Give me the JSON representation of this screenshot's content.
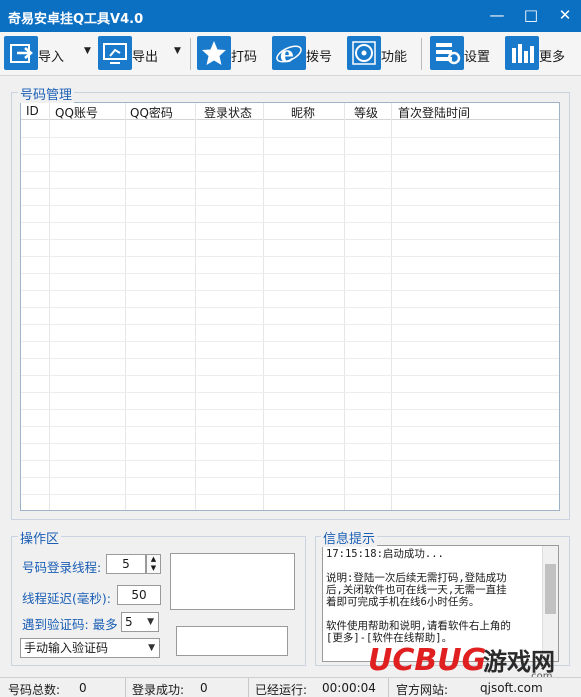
{
  "window": {
    "title": "奇易安卓挂Q工具V4.0"
  },
  "toolbar": {
    "import": "导入",
    "export": "导出",
    "dama": "打码",
    "dial": "拨号",
    "features": "功能",
    "settings": "设置",
    "more": "更多"
  },
  "accounts": {
    "group_title": "号码管理",
    "columns": [
      "ID",
      "QQ账号",
      "QQ密码",
      "登录状态",
      "昵称",
      "等级",
      "首次登陆时间"
    ]
  },
  "ops": {
    "group_title": "操作区",
    "threads_label": "号码登录线程:",
    "threads_value": "5",
    "delay_label": "线程延迟(毫秒):",
    "delay_value": "50",
    "captcha_label": "遇到验证码: 最多",
    "captcha_max": "5",
    "captcha_mode": "手动输入验证码"
  },
  "info": {
    "group_title": "信息提示",
    "lines": [
      "17:15:18:启动成功...",
      "",
      "说明:登陆一次后续无需打码,登陆成功",
      "后,关闭软件也可在线一天,无需一直挂",
      "着即可完成手机在线6小时任务。",
      "",
      "软件使用帮助和说明,请看软件右上角的",
      "[更多]-[软件在线帮助]。"
    ]
  },
  "status": {
    "total_label": "号码总数:",
    "total": "0",
    "success_label": "登录成功:",
    "success": "0",
    "runtime_label": "已经运行:",
    "runtime": "00:00:04",
    "site_label": "官方网站:",
    "site": "qjsoft.com"
  },
  "watermark": {
    "brand": "UCBUG",
    "suffix": "游戏网",
    "domain": ".com"
  },
  "colors": {
    "titlebar": "#0b6fc2",
    "accent": "#1979ca",
    "group_title": "#1b5fb5"
  }
}
